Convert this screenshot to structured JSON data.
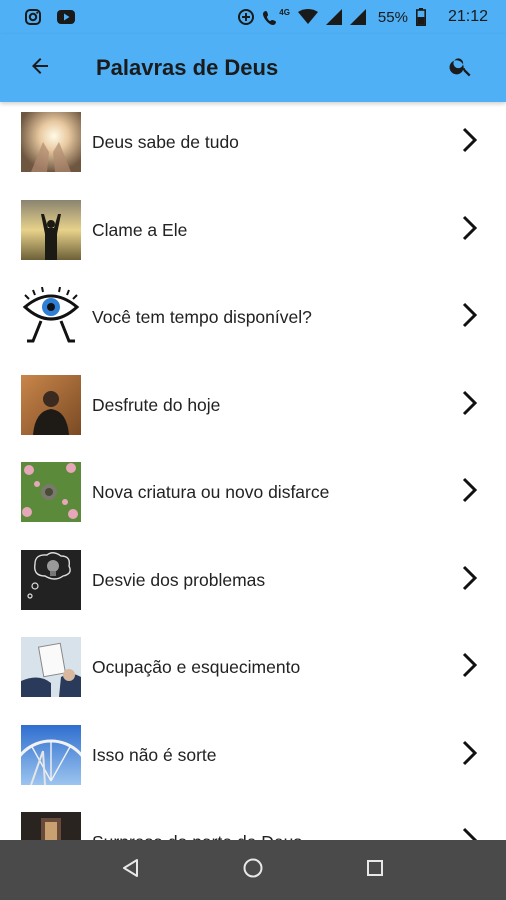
{
  "status_bar": {
    "battery": "55%",
    "time": "21:12",
    "network": "4G",
    "icons": [
      "instagram-icon",
      "youtube-icon",
      "data-saver-icon",
      "wifi-call-icon",
      "wifi-icon",
      "signal-icon",
      "battery-icon"
    ]
  },
  "app_bar": {
    "title": "Palavras de Deus",
    "back_icon": "arrow-back-icon",
    "search_icon": "search-icon",
    "background": "#4fb0f5"
  },
  "list": {
    "items": [
      {
        "label": "Deus sabe de tudo"
      },
      {
        "label": "Clame a Ele"
      },
      {
        "label": "Você tem tempo disponível?"
      },
      {
        "label": "Desfrute do hoje"
      },
      {
        "label": "Nova criatura ou novo disfarce"
      },
      {
        "label": "Desvie dos problemas"
      },
      {
        "label": "Ocupação e esquecimento"
      },
      {
        "label": "Isso não é sorte"
      },
      {
        "label": "Surpresa da parte de Deus"
      }
    ],
    "chevron_icon": "chevron-right-icon"
  },
  "nav_bar": {
    "buttons": [
      "back-triangle-icon",
      "home-circle-icon",
      "recents-square-icon"
    ],
    "background": "#4a4a4a"
  }
}
